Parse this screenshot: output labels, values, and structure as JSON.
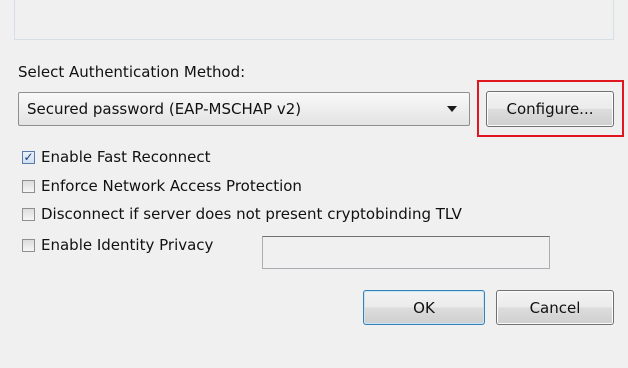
{
  "authentication": {
    "section_label": "Select Authentication Method:",
    "method_selected": "Secured password (EAP-MSCHAP v2)",
    "configure_label": "Configure..."
  },
  "options": [
    {
      "label": "Enable Fast Reconnect",
      "checked": true
    },
    {
      "label": "Enforce Network Access Protection",
      "checked": false
    },
    {
      "label": "Disconnect if server does not present cryptobinding TLV",
      "checked": false
    },
    {
      "label": "Enable Identity Privacy",
      "checked": false
    }
  ],
  "identity_privacy_value": "",
  "buttons": {
    "ok_label": "OK",
    "cancel_label": "Cancel"
  },
  "colors": {
    "highlight": "#e0171f",
    "checkmark": "#1e3c78",
    "dialog_background": "#f0f0f0"
  }
}
